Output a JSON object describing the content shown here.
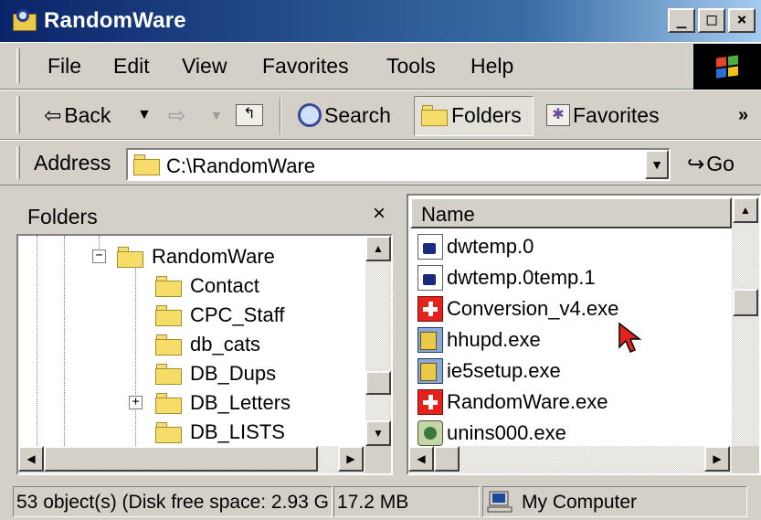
{
  "window": {
    "title": "RandomWare"
  },
  "menu": [
    "File",
    "Edit",
    "View",
    "Favorites",
    "Tools",
    "Help"
  ],
  "toolbar": {
    "back": "Back",
    "search": "Search",
    "folders": "Folders",
    "favorites": "Favorites",
    "more": "»"
  },
  "address": {
    "label": "Address",
    "value": "C:\\RandomWare",
    "go": "Go"
  },
  "folders_pane": {
    "title": "Folders",
    "close": "×",
    "items": [
      "RandomWare",
      "Contact",
      "CPC_Staff",
      "db_cats",
      "DB_Dups",
      "DB_Letters",
      "DB_LISTS"
    ]
  },
  "files": {
    "column": "Name",
    "items": [
      "dwtemp.0",
      "dwtemp.0temp.1",
      "Conversion_v4.exe",
      "hhupd.exe",
      "ie5setup.exe",
      "RandomWare.exe",
      "unins000.exe"
    ]
  },
  "status": {
    "objects": "53 object(s) (Disk free space: 2.93 G",
    "size": "17.2 MB",
    "zone": "My Computer"
  },
  "colors": {
    "title_start": "#0a246a",
    "title_end": "#a6caf0",
    "face": "#d4d0c8"
  }
}
